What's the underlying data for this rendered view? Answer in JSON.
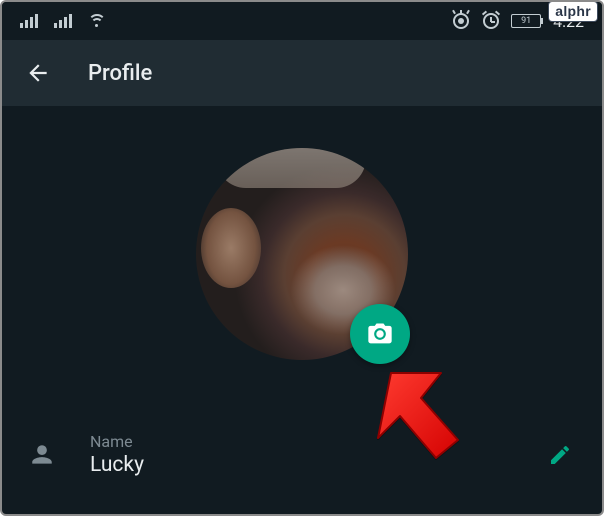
{
  "watermark": "alphr",
  "status": {
    "battery": "91",
    "time": "4:22"
  },
  "appbar": {
    "title": "Profile"
  },
  "fields": {
    "name": {
      "label": "Name",
      "value": "Lucky"
    }
  },
  "icons": {
    "back": "arrow-left-icon",
    "camera": "camera-icon",
    "person": "person-icon",
    "edit": "pencil-icon",
    "wifi": "wifi-icon",
    "signal1": "signal-1-icon",
    "signal2": "signal-2-icon",
    "visibility": "visibility-icon",
    "alarm": "alarm-icon",
    "battery": "battery-icon"
  },
  "colors": {
    "accent": "#00a884",
    "background": "#111b21",
    "appbar": "#202c33",
    "text_primary": "#e9edef",
    "text_secondary": "#7d8a92"
  }
}
